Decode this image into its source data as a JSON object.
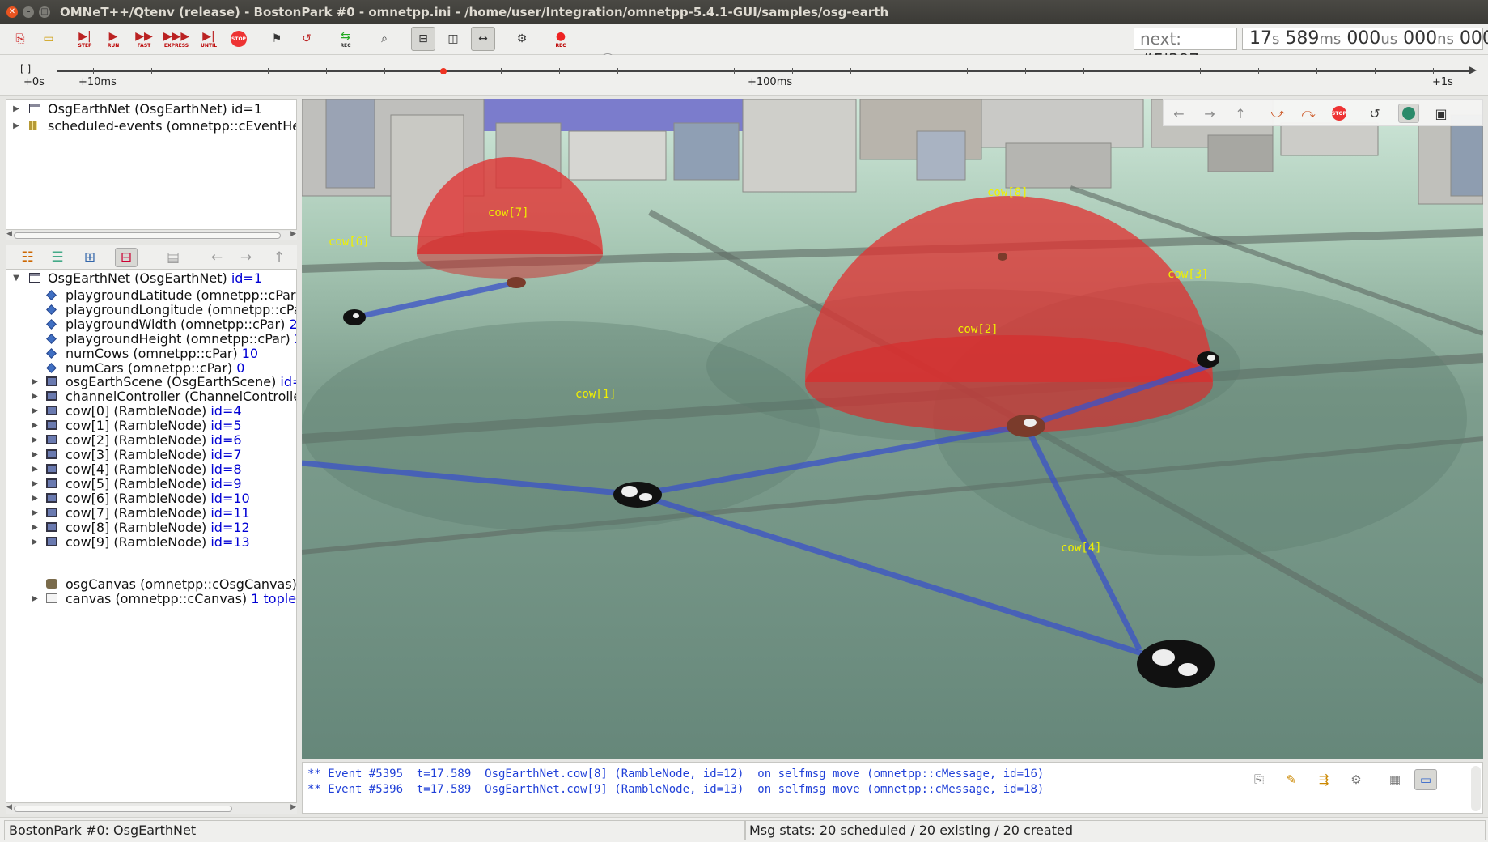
{
  "window": {
    "title": "OMNeT++/Qtenv (release) - BostonPark #0 - omnetpp.ini - /home/user/Integration/omnetpp-5.4.1-GUI/samples/osg-earth"
  },
  "toolbar": {
    "step_label": "STEP",
    "run_label": "RUN",
    "fast_label": "FAST",
    "express_label": "EXPRESS",
    "until_label": "UNTIL",
    "stop_label": "STOP",
    "rec_label": "REC",
    "rec2_label": "REC",
    "next_prefix": "next:",
    "next_event": "#5'397",
    "simtime": {
      "s_val": "17",
      "s_unit": "s",
      "ms_val": "589",
      "ms_unit": "ms",
      "us_val": "000",
      "us_unit": "us",
      "ns_val": "000",
      "ns_unit": "ns",
      "ps_val": "000",
      "ps_unit": "ps"
    },
    "speed_level": 0.3
  },
  "timeline": {
    "bracket": "[ ]",
    "labels": [
      "+0s",
      "+10ms",
      "+100ms",
      "+1s"
    ]
  },
  "object_tree": {
    "items": [
      {
        "label": "OsgEarthNet (OsgEarthNet)",
        "id": "id=1"
      },
      {
        "label": "scheduled-events (omnetpp::cEventHea",
        "id": ""
      }
    ]
  },
  "inspector_tree": {
    "root": {
      "label": "OsgEarthNet (OsgEarthNet)",
      "id": "id=1"
    },
    "params": [
      {
        "label": "playgroundLatitude (omnetpp::cPar)",
        "value": ""
      },
      {
        "label": "playgroundLongitude (omnetpp::cPa",
        "value": ""
      },
      {
        "label": "playgroundWidth (omnetpp::cPar)",
        "value": "25"
      },
      {
        "label": "playgroundHeight (omnetpp::cPar)",
        "value": "2"
      },
      {
        "label": "numCows (omnetpp::cPar)",
        "value": "10"
      },
      {
        "label": "numCars (omnetpp::cPar)",
        "value": "0"
      }
    ],
    "modules": [
      {
        "label": "osgEarthScene (OsgEarthScene)",
        "id": "id=2"
      },
      {
        "label": "channelController (ChannelControlle",
        "id": ""
      },
      {
        "label": "cow[0] (RambleNode)",
        "id": "id=4"
      },
      {
        "label": "cow[1] (RambleNode)",
        "id": "id=5"
      },
      {
        "label": "cow[2] (RambleNode)",
        "id": "id=6"
      },
      {
        "label": "cow[3] (RambleNode)",
        "id": "id=7"
      },
      {
        "label": "cow[4] (RambleNode)",
        "id": "id=8"
      },
      {
        "label": "cow[5] (RambleNode)",
        "id": "id=9"
      },
      {
        "label": "cow[6] (RambleNode)",
        "id": "id=10"
      },
      {
        "label": "cow[7] (RambleNode)",
        "id": "id=11"
      },
      {
        "label": "cow[8] (RambleNode)",
        "id": "id=12"
      },
      {
        "label": "cow[9] (RambleNode)",
        "id": "id=13"
      }
    ],
    "osg_canvas": {
      "label": "osgCanvas (omnetpp::cOsgCanvas)"
    },
    "canvas": {
      "label": "canvas (omnetpp::cCanvas)",
      "extra": "1 topleve"
    }
  },
  "scene": {
    "cows": [
      {
        "label": "cow[1]"
      },
      {
        "label": "cow[2]"
      },
      {
        "label": "cow[3]"
      },
      {
        "label": "cow[4]"
      },
      {
        "label": "cow[6]"
      },
      {
        "label": "cow[7]"
      },
      {
        "label": "cow[8]"
      }
    ]
  },
  "log": {
    "lines": [
      "** Event #5395  t=17.589  OsgEarthNet.cow[8] (RambleNode, id=12)  on selfmsg move (omnetpp::cMessage, id=16)",
      "** Event #5396  t=17.589  OsgEarthNet.cow[9] (RambleNode, id=13)  on selfmsg move (omnetpp::cMessage, id=18)"
    ]
  },
  "status": {
    "network": "BostonPark #0: OsgEarthNet",
    "msg_stats": "Msg stats: 20 scheduled / 20 existing / 20 created"
  }
}
